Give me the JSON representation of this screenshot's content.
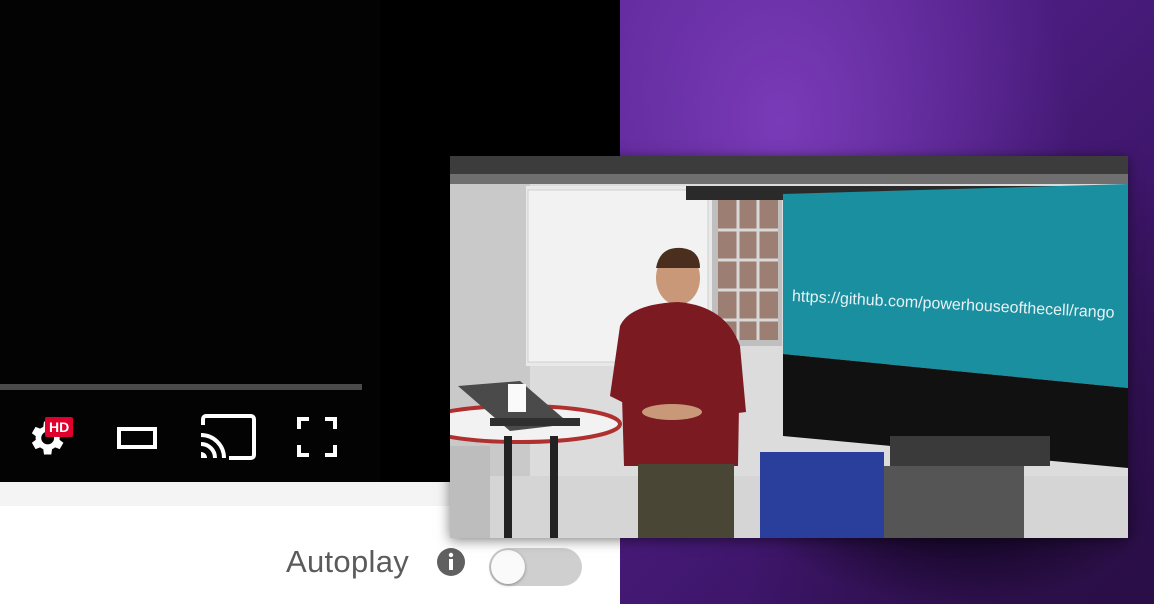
{
  "player": {
    "hd_badge": "HD",
    "controls": [
      "settings-icon",
      "theater-mode-icon",
      "cast-icon",
      "fullscreen-icon"
    ]
  },
  "autoplay": {
    "label": "Autoplay",
    "enabled": false
  },
  "mini_video": {
    "screen_text": "https://github.com/powerhouseofthecell/rango"
  },
  "colors": {
    "accent_red": "#e1002d",
    "purple": "#4a1c7e",
    "screen_teal": "#1a8fa0"
  }
}
